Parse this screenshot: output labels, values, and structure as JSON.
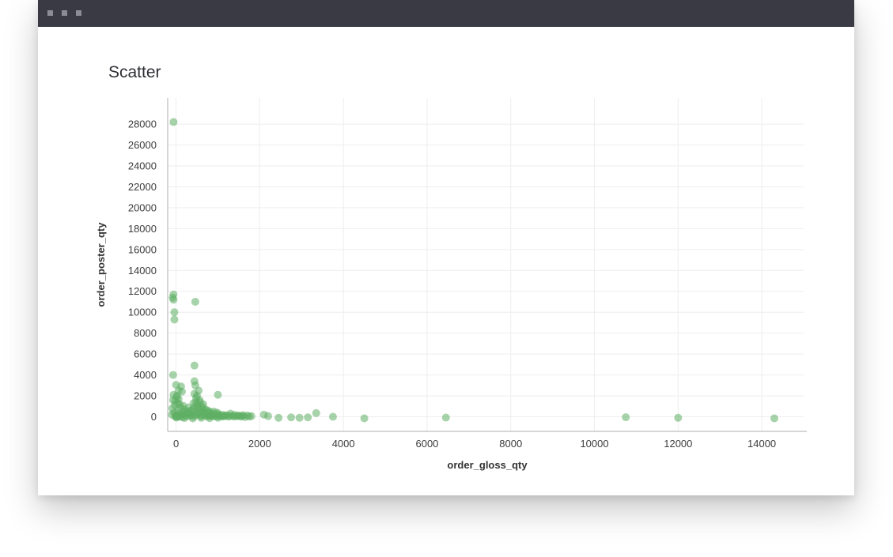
{
  "window": {
    "title_bar_buttons": [
      "dot-1",
      "dot-2",
      "dot-3"
    ]
  },
  "card": {
    "title": "Scatter"
  },
  "colors": {
    "point": "#5fae64",
    "grid": "#eeeeee",
    "axis": "#c8c8c8",
    "tick_text": "#3c3c3c",
    "title_bar": "#3a3a45"
  },
  "chart_data": {
    "type": "scatter",
    "title": "Scatter",
    "xlabel": "order_gloss_qty",
    "ylabel": "order_poster_qty",
    "xlim": [
      -200,
      15000
    ],
    "ylim": [
      -1400,
      30500
    ],
    "xticks": [
      0,
      2000,
      4000,
      6000,
      8000,
      10000,
      12000,
      14000
    ],
    "yticks": [
      0,
      2000,
      4000,
      6000,
      8000,
      10000,
      12000,
      14000,
      16000,
      18000,
      20000,
      22000,
      24000,
      26000,
      28000
    ],
    "grid": true,
    "series": [
      {
        "points": [
          [
            -60,
            28200
          ],
          [
            -60,
            11700
          ],
          [
            -80,
            11400
          ],
          [
            -60,
            11200
          ],
          [
            460,
            11000
          ],
          [
            -40,
            10000
          ],
          [
            -40,
            9300
          ],
          [
            440,
            4900
          ],
          [
            -70,
            4000
          ],
          [
            0,
            3050
          ],
          [
            120,
            2900
          ],
          [
            440,
            3400
          ],
          [
            460,
            3000
          ],
          [
            540,
            2500
          ],
          [
            140,
            2400
          ],
          [
            -60,
            2100
          ],
          [
            20,
            1900
          ],
          [
            1000,
            2100
          ],
          [
            60,
            1700
          ],
          [
            -20,
            1500
          ],
          [
            80,
            1200
          ],
          [
            480,
            1800
          ],
          [
            560,
            1600
          ],
          [
            420,
            1300
          ],
          [
            300,
            900
          ],
          [
            200,
            700
          ],
          [
            620,
            1000
          ],
          [
            700,
            700
          ],
          [
            800,
            500
          ],
          [
            900,
            300
          ],
          [
            1000,
            250
          ],
          [
            1100,
            200
          ],
          [
            1200,
            150
          ],
          [
            1300,
            300
          ],
          [
            1400,
            180
          ],
          [
            1500,
            100
          ],
          [
            1600,
            150
          ],
          [
            1700,
            120
          ],
          [
            1800,
            60
          ],
          [
            2100,
            200
          ],
          [
            2200,
            60
          ],
          [
            2450,
            -100
          ],
          [
            2750,
            -60
          ],
          [
            2950,
            -100
          ],
          [
            3150,
            -60
          ],
          [
            3350,
            350
          ],
          [
            3750,
            0
          ],
          [
            4500,
            -150
          ],
          [
            6450,
            -80
          ],
          [
            10750,
            -50
          ],
          [
            12000,
            -100
          ],
          [
            14300,
            -150
          ],
          [
            -100,
            200
          ],
          [
            -50,
            400
          ],
          [
            0,
            100
          ],
          [
            30,
            600
          ],
          [
            60,
            300
          ],
          [
            100,
            50
          ],
          [
            140,
            250
          ],
          [
            180,
            500
          ],
          [
            220,
            150
          ],
          [
            260,
            350
          ],
          [
            320,
            80
          ],
          [
            360,
            600
          ],
          [
            380,
            200
          ],
          [
            440,
            450
          ],
          [
            500,
            250
          ],
          [
            520,
            900
          ],
          [
            580,
            120
          ],
          [
            640,
            400
          ],
          [
            680,
            180
          ],
          [
            740,
            300
          ],
          [
            780,
            80
          ],
          [
            840,
            200
          ],
          [
            880,
            50
          ],
          [
            940,
            120
          ],
          [
            1020,
            80
          ],
          [
            1080,
            30
          ],
          [
            1150,
            60
          ],
          [
            1250,
            20
          ],
          [
            1350,
            100
          ],
          [
            1450,
            40
          ],
          [
            1550,
            10
          ],
          [
            1650,
            -30
          ],
          [
            1750,
            20
          ],
          [
            -20,
            50
          ],
          [
            10,
            -80
          ],
          [
            50,
            20
          ],
          [
            90,
            150
          ],
          [
            150,
            -50
          ],
          [
            250,
            60
          ],
          [
            330,
            220
          ],
          [
            410,
            20
          ],
          [
            470,
            120
          ],
          [
            530,
            340
          ],
          [
            600,
            60
          ],
          [
            660,
            250
          ],
          [
            720,
            30
          ],
          [
            760,
            150
          ],
          [
            820,
            60
          ],
          [
            860,
            110
          ],
          [
            960,
            30
          ],
          [
            1040,
            140
          ],
          [
            1120,
            40
          ],
          [
            1180,
            90
          ],
          [
            1280,
            60
          ],
          [
            1380,
            20
          ],
          [
            1480,
            110
          ],
          [
            1580,
            70
          ],
          [
            -90,
            800
          ],
          [
            -30,
            1100
          ],
          [
            40,
            1300
          ],
          [
            110,
            900
          ],
          [
            170,
            1050
          ],
          [
            240,
            400
          ],
          [
            300,
            500
          ],
          [
            400,
            700
          ],
          [
            450,
            950
          ],
          [
            480,
            1400
          ],
          [
            510,
            1150
          ],
          [
            550,
            750
          ],
          [
            590,
            550
          ],
          [
            630,
            800
          ],
          [
            700,
            450
          ],
          [
            750,
            600
          ],
          [
            810,
            350
          ],
          [
            900,
            500
          ],
          [
            980,
            400
          ],
          [
            -70,
            1600
          ],
          [
            20,
            2000
          ],
          [
            60,
            2500
          ],
          [
            440,
            2200
          ],
          [
            500,
            2000
          ],
          [
            570,
            1400
          ],
          [
            650,
            1200
          ],
          [
            0,
            0
          ],
          [
            200,
            -120
          ],
          [
            400,
            -150
          ],
          [
            600,
            -100
          ],
          [
            800,
            -130
          ],
          [
            1000,
            -90
          ]
        ]
      }
    ]
  }
}
